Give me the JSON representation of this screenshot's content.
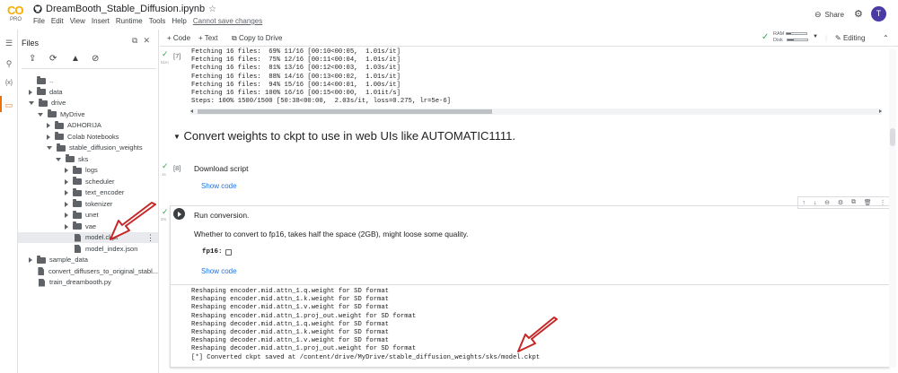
{
  "app": {
    "logo_text": "CO",
    "plan_badge": "PRO",
    "notebook_title": "DreamBooth_Stable_Diffusion.ipynb",
    "menu": [
      "File",
      "Edit",
      "View",
      "Insert",
      "Runtime",
      "Tools",
      "Help"
    ],
    "unsaved_notice": "Cannot save changes",
    "share_label": "Share",
    "avatar_initial": "T",
    "brand_color": "#f9ab00",
    "avatar_color": "#4a3aa6"
  },
  "files_panel": {
    "title": "Files",
    "tree": [
      {
        "label": "..",
        "kind": "folder",
        "depth": 0,
        "caret": "none"
      },
      {
        "label": "data",
        "kind": "folder",
        "depth": 0,
        "caret": "right"
      },
      {
        "label": "drive",
        "kind": "folder",
        "depth": 0,
        "caret": "down"
      },
      {
        "label": "MyDrive",
        "kind": "folder",
        "depth": 1,
        "caret": "down"
      },
      {
        "label": "ADHORIJA",
        "kind": "folder",
        "depth": 2,
        "caret": "right"
      },
      {
        "label": "Colab Notebooks",
        "kind": "folder",
        "depth": 2,
        "caret": "right"
      },
      {
        "label": "stable_diffusion_weights",
        "kind": "folder",
        "depth": 2,
        "caret": "down"
      },
      {
        "label": "sks",
        "kind": "folder",
        "depth": 3,
        "caret": "down"
      },
      {
        "label": "logs",
        "kind": "folder",
        "depth": 4,
        "caret": "right"
      },
      {
        "label": "scheduler",
        "kind": "folder",
        "depth": 4,
        "caret": "right"
      },
      {
        "label": "text_encoder",
        "kind": "folder",
        "depth": 4,
        "caret": "right"
      },
      {
        "label": "tokenizer",
        "kind": "folder",
        "depth": 4,
        "caret": "right"
      },
      {
        "label": "unet",
        "kind": "folder",
        "depth": 4,
        "caret": "right"
      },
      {
        "label": "vae",
        "kind": "folder",
        "depth": 4,
        "caret": "right"
      },
      {
        "label": "model.ckpt",
        "kind": "file",
        "depth": 4,
        "caret": "none",
        "selected": true
      },
      {
        "label": "model_index.json",
        "kind": "file",
        "depth": 4,
        "caret": "none"
      },
      {
        "label": "sample_data",
        "kind": "folder",
        "depth": 0,
        "caret": "right"
      },
      {
        "label": "convert_diffusers_to_original_stabl...",
        "kind": "file",
        "depth": 0,
        "caret": "none"
      },
      {
        "label": "train_dreambooth.py",
        "kind": "file",
        "depth": 0,
        "caret": "none"
      }
    ]
  },
  "toolbar": {
    "add_code": "+ Code",
    "add_text": "+ Text",
    "copy_to_drive": "Copy to Drive",
    "ram_label": "RAM",
    "disk_label": "Disk",
    "ram_fraction": 0.2,
    "disk_fraction": 0.35,
    "editing_label": "Editing"
  },
  "cells": {
    "cell7": {
      "number": "[7]",
      "runtime": "51m",
      "output_lines": [
        "Fetching 16 files:  69% 11/16 [00:10<00:05,  1.01s/it]",
        "Fetching 16 files:  75% 12/16 [00:11<00:04,  1.01s/it]",
        "Fetching 16 files:  81% 13/16 [00:12<00:03,  1.03s/it]",
        "Fetching 16 files:  88% 14/16 [00:13<00:02,  1.01s/it]",
        "Fetching 16 files:  94% 15/16 [00:14<00:01,  1.00s/it]",
        "Fetching 16 files: 100% 16/16 [00:15<00:00,  1.01it/s]",
        "Steps: 100% 1500/1500 [50:38<00:00,  2.03s/it, loss=0.275, lr=5e-6]"
      ]
    },
    "section_heading": "Convert weights to ckpt to use in web UIs like AUTOMATIC1111.",
    "cell8": {
      "number": "[8]",
      "runtime": "1s",
      "title": "Download script",
      "show_code": "Show code"
    },
    "cell9": {
      "runtime": "2m",
      "title": "Run conversion.",
      "description": "Whether to convert to fp16, takes half the space (2GB), might loose some quality.",
      "param_label": "fp16:",
      "param_checked": false,
      "show_code": "Show code",
      "output_lines": [
        "Reshaping encoder.mid.attn_1.q.weight for SD format",
        "Reshaping encoder.mid.attn_1.k.weight for SD format",
        "Reshaping encoder.mid.attn_1.v.weight for SD format",
        "Reshaping encoder.mid.attn_1.proj_out.weight for SD format",
        "Reshaping decoder.mid.attn_1.q.weight for SD format",
        "Reshaping decoder.mid.attn_1.k.weight for SD format",
        "Reshaping decoder.mid.attn_1.v.weight for SD format",
        "Reshaping decoder.mid.attn_1.proj_out.weight for SD format",
        "[*] Converted ckpt saved at /content/drive/MyDrive/stable_diffusion_weights/sks/model.ckpt"
      ]
    }
  },
  "annotations": {
    "arrow_color": "#c62828"
  }
}
